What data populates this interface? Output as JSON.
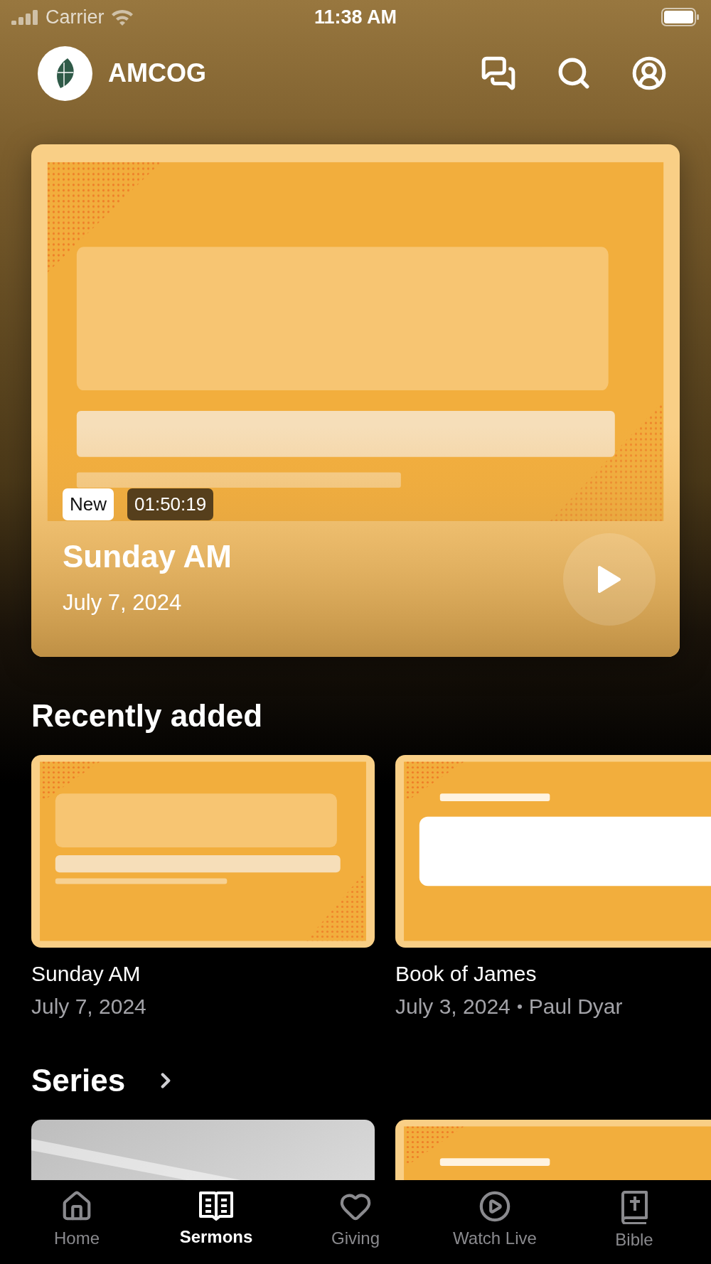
{
  "status_bar": {
    "carrier": "Carrier",
    "time": "11:38 AM"
  },
  "header": {
    "title": "AMCOG"
  },
  "featured": {
    "badges": [
      {
        "kind": "new",
        "text": "New"
      },
      {
        "kind": "duration",
        "text": "01:50:19"
      }
    ],
    "title": "Sunday AM",
    "date": "July 7, 2024"
  },
  "recently_added": {
    "heading": "Recently added",
    "items": [
      {
        "title": "Sunday AM",
        "date": "July 7, 2024"
      },
      {
        "title": "Book of James",
        "date": "July 3, 2024",
        "speaker": "Paul Dyar"
      }
    ]
  },
  "series": {
    "heading": "Series"
  },
  "tabs": [
    {
      "label": "Home",
      "selected": false
    },
    {
      "label": "Sermons",
      "selected": true
    },
    {
      "label": "Giving",
      "selected": false
    },
    {
      "label": "Watch Live",
      "selected": false
    },
    {
      "label": "Bible",
      "selected": false
    }
  ]
}
